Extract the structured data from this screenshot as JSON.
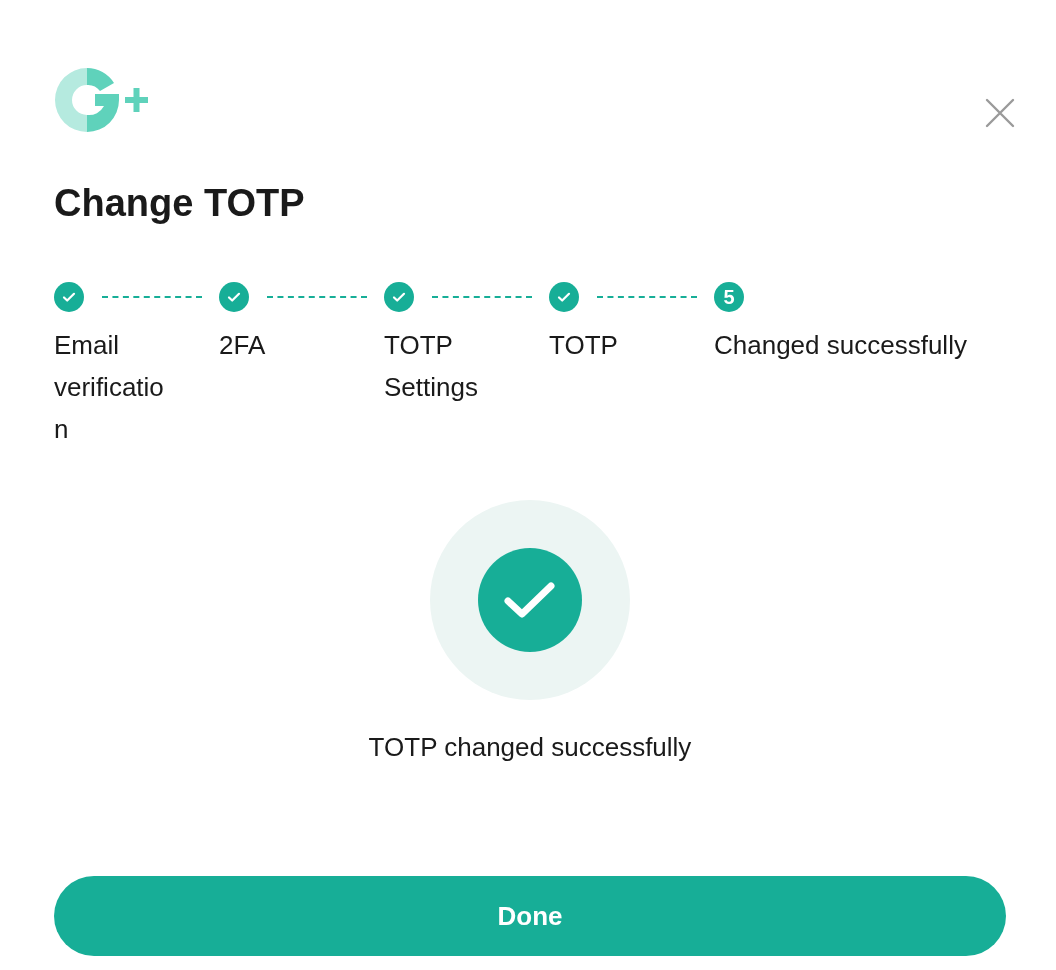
{
  "dialog": {
    "title": "Change TOTP",
    "steps": [
      {
        "label": "Email verification",
        "completed": true
      },
      {
        "label": "2FA",
        "completed": true
      },
      {
        "label": "TOTP Settings",
        "completed": true
      },
      {
        "label": "TOTP",
        "completed": true
      },
      {
        "label": "Changed successfully",
        "completed": false,
        "number": "5"
      }
    ],
    "message": "TOTP changed successfully",
    "button": "Done"
  }
}
